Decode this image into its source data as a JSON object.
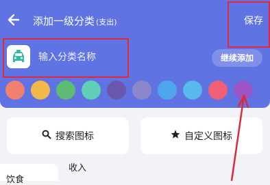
{
  "header": {
    "title": "添加一级分类",
    "title_sub": "(支出)",
    "save_label": "保存",
    "background": "#5f73e2"
  },
  "category": {
    "icon": "taxi-icon",
    "icon_color": "#31b9a8",
    "name_placeholder": "输入分类名称",
    "name_value": "",
    "continue_label": "继续添加"
  },
  "color_swatches": [
    "#f08070",
    "#f3b84a",
    "#5fbb74",
    "#5fd0b6",
    "#6a58b0",
    "#8c86cb",
    "#4fa6ed",
    "#58b9ec",
    "#ef6077",
    "#9b55c4"
  ],
  "actions": {
    "search_icons_label": "搜索图标",
    "custom_icon_label": "自定义图标"
  },
  "tabs": {
    "income_label": "收入"
  },
  "sidebar": {
    "items": [
      {
        "label": "饮食"
      }
    ]
  },
  "annotation_color": "#e0283a"
}
